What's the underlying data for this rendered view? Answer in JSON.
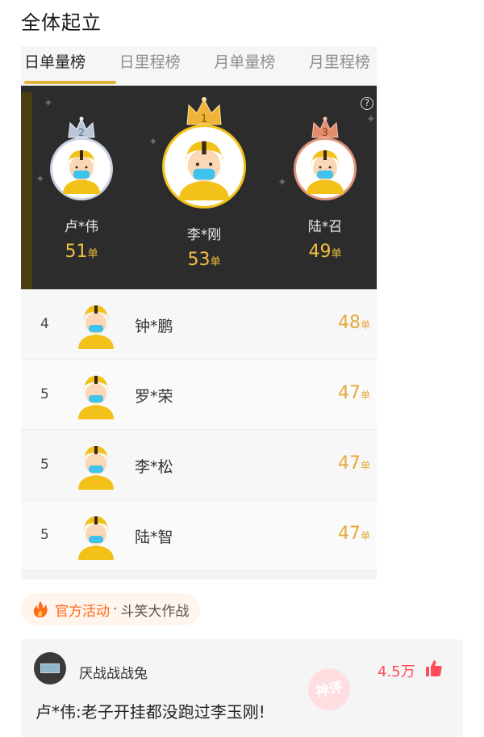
{
  "post": {
    "title": "全体起立"
  },
  "tabs": [
    {
      "label": "日单量榜",
      "active": true
    },
    {
      "label": "日里程榜",
      "active": false
    },
    {
      "label": "月单量榜",
      "active": false
    },
    {
      "label": "月里程榜",
      "active": false
    }
  ],
  "podium": {
    "help_icon": "?",
    "top3": [
      {
        "rank": "2",
        "name": "卢*伟",
        "count": "51",
        "unit": "单",
        "crown_color": "#b9c6d8"
      },
      {
        "rank": "1",
        "name": "李*刚",
        "count": "53",
        "unit": "单",
        "crown_color": "#f0b43a"
      },
      {
        "rank": "3",
        "name": "陆*召",
        "count": "49",
        "unit": "单",
        "crown_color": "#e58a6a"
      }
    ]
  },
  "list": [
    {
      "rank": "4",
      "name": "钟*鹏",
      "count": "48",
      "unit": "单"
    },
    {
      "rank": "5",
      "name": "罗*荣",
      "count": "47",
      "unit": "单"
    },
    {
      "rank": "5",
      "name": "李*松",
      "count": "47",
      "unit": "单"
    },
    {
      "rank": "5",
      "name": "陆*智",
      "count": "47",
      "unit": "单"
    }
  ],
  "activity": {
    "label": "官方活动",
    "separator": "·",
    "name": "斗笑大作战",
    "icon": "fire-icon"
  },
  "comment": {
    "username": "厌战战战兔",
    "likes": "4.5万",
    "stamp": "神评",
    "text": "卢*伟:老子开挂都没跑过李玉刚!"
  },
  "colors": {
    "accent": "#e2b53a",
    "count": "#e5a93a",
    "like": "#ff4d5a",
    "activity": "#ff6a1a"
  }
}
